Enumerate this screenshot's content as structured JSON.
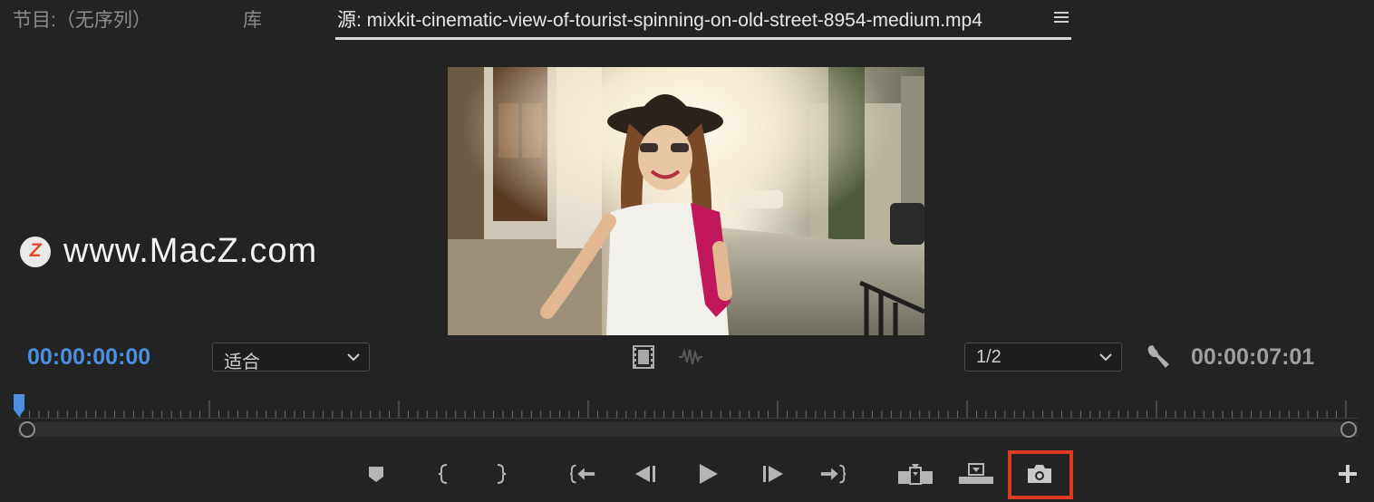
{
  "tabs": [
    {
      "label": "节目:（无序列）",
      "active": false
    },
    {
      "label": "库",
      "active": false
    },
    {
      "label": "源: mixkit-cinematic-view-of-tourist-spinning-on-old-street-8954-medium.mp4",
      "active": true
    }
  ],
  "watermark": {
    "logo_letter": "Z",
    "text": "www.MacZ.com"
  },
  "timecode_current": "00:00:00:00",
  "timecode_duration": "00:00:07:01",
  "zoom_dropdown": {
    "value": "适合"
  },
  "resolution_dropdown": {
    "value": "1/2"
  },
  "controls": [
    "marker-icon",
    "mark-in-icon",
    "mark-out-icon",
    "go-to-in-icon",
    "step-back-icon",
    "play-icon",
    "step-forward-icon",
    "go-to-out-icon",
    "insert-icon",
    "overwrite-icon",
    "export-frame-icon",
    "add-button-icon"
  ],
  "colors": {
    "accent_blue": "#4a8fe0",
    "highlight_red": "#e03a22"
  }
}
